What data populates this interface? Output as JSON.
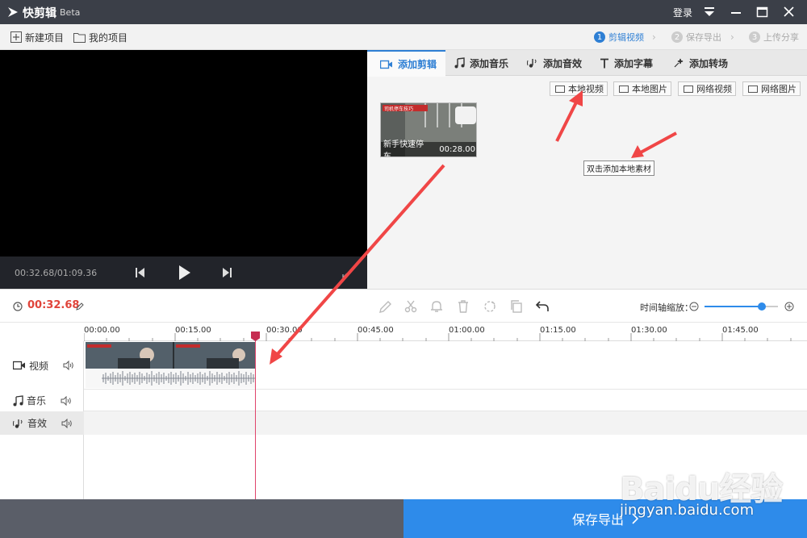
{
  "titlebar": {
    "app_name": "快剪辑",
    "badge": "Beta",
    "login": "登录"
  },
  "menubar": {
    "new_project": "新建项目",
    "my_projects": "我的项目",
    "steps": [
      {
        "num": "1",
        "label": "剪辑视频"
      },
      {
        "num": "2",
        "label": "保存导出"
      },
      {
        "num": "3",
        "label": "上传分享"
      }
    ]
  },
  "preview": {
    "timecode": "00:32.68/01:09.36"
  },
  "media": {
    "tabs": [
      {
        "label": "添加剪辑",
        "icon": "video-camera-icon"
      },
      {
        "label": "添加音乐",
        "icon": "music-note-icon"
      },
      {
        "label": "添加音效",
        "icon": "sound-effect-icon"
      },
      {
        "label": "添加字幕",
        "icon": "text-t-icon"
      },
      {
        "label": "添加转场",
        "icon": "transition-icon"
      }
    ],
    "source_buttons": [
      {
        "label": "本地视频"
      },
      {
        "label": "本地图片"
      },
      {
        "label": "网络视频"
      },
      {
        "label": "网络图片"
      }
    ],
    "clip": {
      "title": "新手快速停车...",
      "duration": "00:28.00",
      "overlay_text": "司机停车技巧"
    },
    "tooltip": "双击添加本地素材"
  },
  "toolbar": {
    "current_time": "00:32.68",
    "zoom_label": "时间轴缩放：",
    "zoom_level": 0.78
  },
  "timeline": {
    "ticks": [
      "00:00.00",
      "00:15.00",
      "00:30.00",
      "00:45.00",
      "01:00.00",
      "01:15.00",
      "01:30.00",
      "01:45.00"
    ],
    "tracks": [
      {
        "label": "视频",
        "icon": "video-track-icon"
      },
      {
        "label": "音乐",
        "icon": "music-track-icon"
      },
      {
        "label": "音效",
        "icon": "sound-effect-track-icon"
      }
    ]
  },
  "bottom": {
    "export_label": "保存导出"
  },
  "watermark": {
    "brand": "Baidu经验",
    "url": "jingyan.baidu.com"
  },
  "colors": {
    "accent": "#2e8bea",
    "timecode": "#e0443a",
    "playhead": "#e0446b",
    "annotation": "#f04646"
  }
}
